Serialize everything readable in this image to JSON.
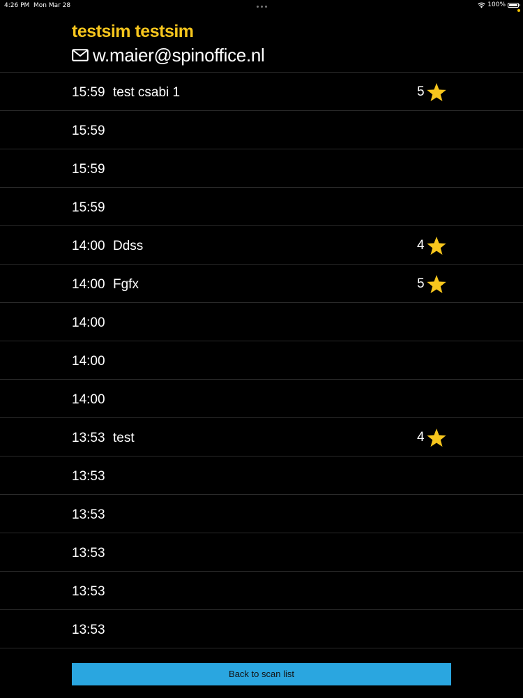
{
  "status_bar": {
    "time": "4:26 PM",
    "date": "Mon Mar 28",
    "battery": "100%"
  },
  "header": {
    "user_name": "testsim testsim",
    "email": "w.maier@spinoffice.nl",
    "mail_icon": "mail-icon"
  },
  "scans": [
    {
      "time": "15:59",
      "name": "test csabi 1",
      "rating": "5"
    },
    {
      "time": "15:59",
      "name": "",
      "rating": ""
    },
    {
      "time": "15:59",
      "name": "",
      "rating": ""
    },
    {
      "time": "15:59",
      "name": "",
      "rating": ""
    },
    {
      "time": "14:00",
      "name": "Ddss",
      "rating": "4"
    },
    {
      "time": "14:00",
      "name": "Fgfx",
      "rating": "5"
    },
    {
      "time": "14:00",
      "name": "",
      "rating": ""
    },
    {
      "time": "14:00",
      "name": "",
      "rating": ""
    },
    {
      "time": "14:00",
      "name": "",
      "rating": ""
    },
    {
      "time": "13:53",
      "name": "test",
      "rating": "4"
    },
    {
      "time": "13:53",
      "name": "",
      "rating": ""
    },
    {
      "time": "13:53",
      "name": "",
      "rating": ""
    },
    {
      "time": "13:53",
      "name": "",
      "rating": ""
    },
    {
      "time": "13:53",
      "name": "",
      "rating": ""
    },
    {
      "time": "13:53",
      "name": "",
      "rating": ""
    }
  ],
  "footer": {
    "back_label": "Back to scan list"
  },
  "colors": {
    "accent_yellow": "#f7c61d",
    "button_blue": "#2aa6e0",
    "background": "#000000"
  }
}
